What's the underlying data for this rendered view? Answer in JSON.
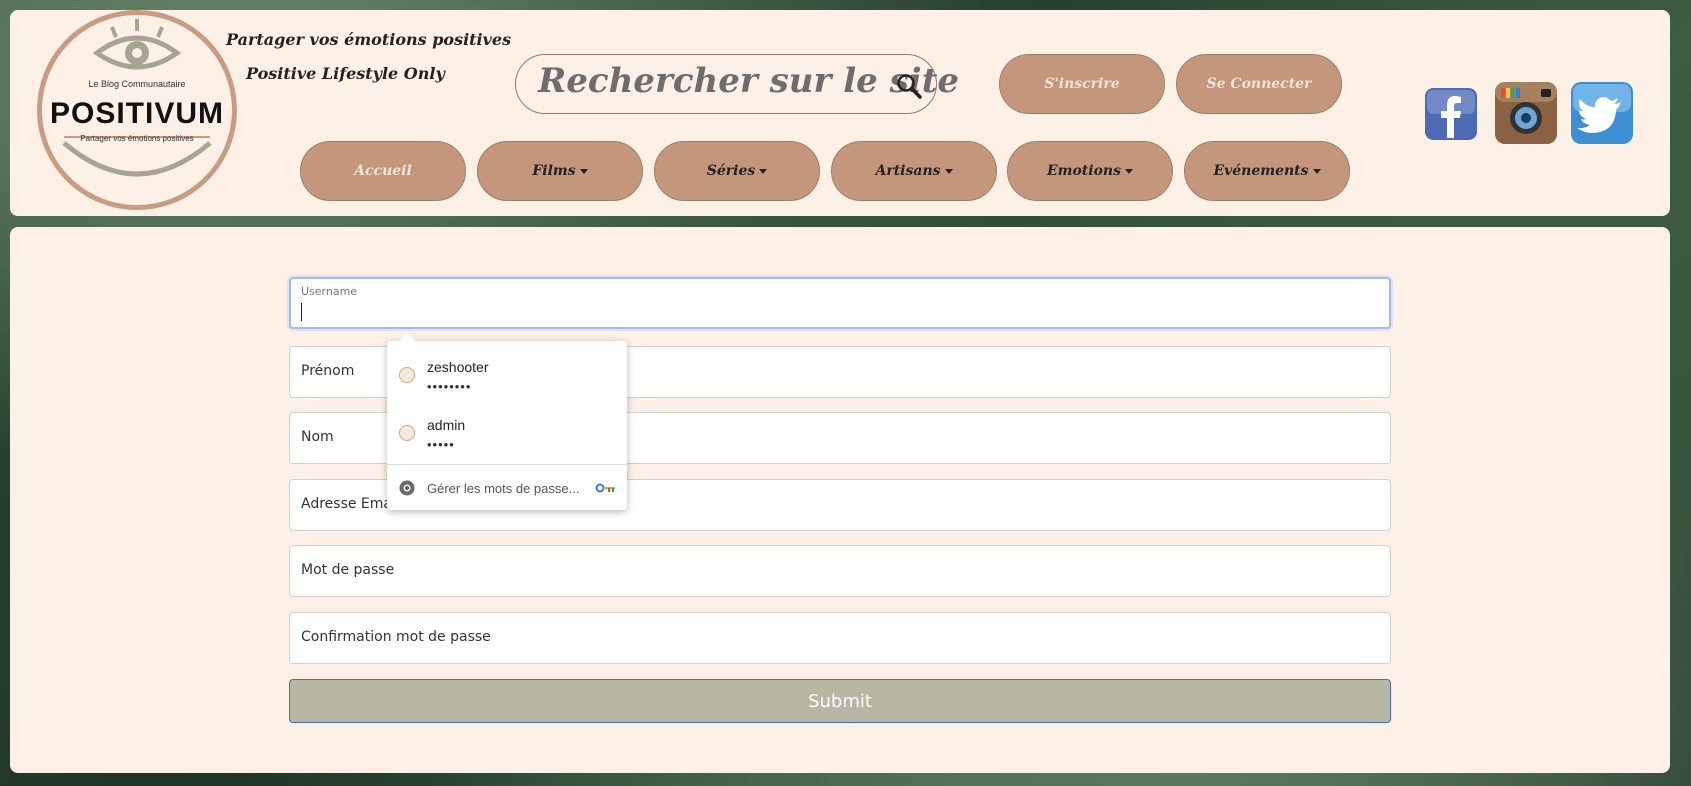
{
  "header": {
    "logo": {
      "small_top": "Le Blog Communautaire",
      "title": "POSITIVUM",
      "small_bottom": "Partager vos émotions positives"
    },
    "tagline1": "Partager vos émotions positives",
    "tagline2": "Positive Lifestyle Only",
    "search_placeholder": "Rechercher sur le site",
    "auth": {
      "signup": "S'inscrire",
      "login": "Se Connecter"
    },
    "nav": [
      {
        "label": "Accueil",
        "dropdown": false
      },
      {
        "label": "Films",
        "dropdown": true
      },
      {
        "label": "Séries",
        "dropdown": true
      },
      {
        "label": "Artisans",
        "dropdown": true
      },
      {
        "label": "Emotions",
        "dropdown": true
      },
      {
        "label": "Evénements",
        "dropdown": true
      }
    ],
    "social": [
      "facebook-icon",
      "instagram-icon",
      "twitter-icon"
    ]
  },
  "form": {
    "username_label": "Username",
    "username_value": "",
    "fields": [
      "Prénom",
      "Nom",
      "Adresse Email",
      "Mot de passe",
      "Confirmation mot de passe"
    ],
    "submit": "Submit"
  },
  "autofill": {
    "accounts": [
      {
        "name": "zeshooter",
        "password_mask": "••••••••"
      },
      {
        "name": "admin",
        "password_mask": "•••••"
      }
    ],
    "manage": "Gérer les mots de passe..."
  },
  "colors": {
    "panel": "#fdf0e6",
    "pill": "#c4977d",
    "submit": "#b8b7a3",
    "accent": "#4a6ad0"
  }
}
